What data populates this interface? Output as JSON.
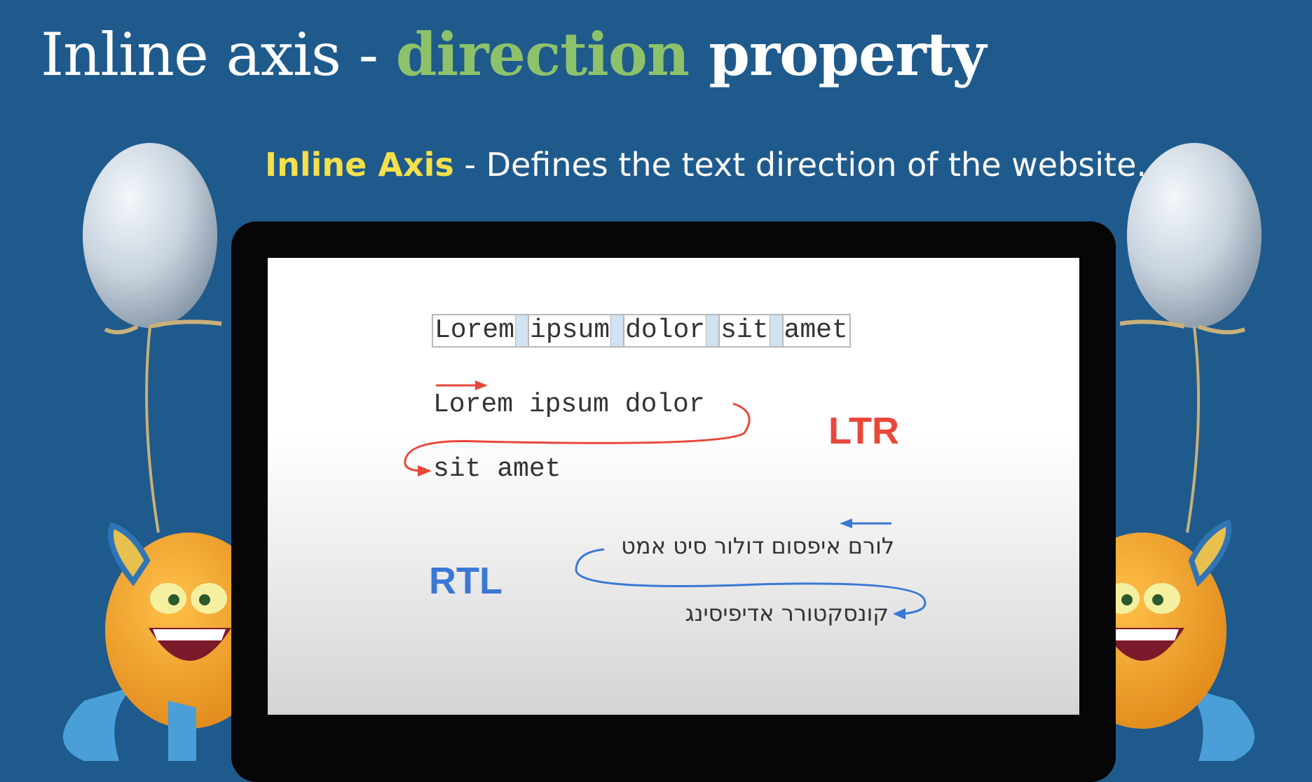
{
  "title": {
    "part1": "Inline axis - ",
    "keyword": "direction",
    "part2": " property"
  },
  "subtitle": {
    "term": "Inline Axis",
    "rest": " - Defines the text direction of the website."
  },
  "screen": {
    "boxed_words": [
      "Lorem",
      "ipsum",
      "dolor",
      "sit",
      "amet"
    ],
    "ltr": {
      "line1": "Lorem ipsum dolor",
      "line2": "sit amet",
      "label": "LTR",
      "color": "#e8473a"
    },
    "rtl": {
      "line1": "לורם איפסום דולור סיט אמט",
      "line2": "קונסקטורר אדיפיסינג",
      "label": "RTL",
      "color": "#3a78d6"
    }
  },
  "colors": {
    "background": "#1f5a8c",
    "keyword": "#8ec26a",
    "term": "#f5e04a",
    "gap_highlight": "#cfe3f3"
  },
  "decorations": {
    "left": [
      "balloon-icon",
      "monster-icon"
    ],
    "right": [
      "balloon-icon",
      "monster-icon"
    ]
  }
}
